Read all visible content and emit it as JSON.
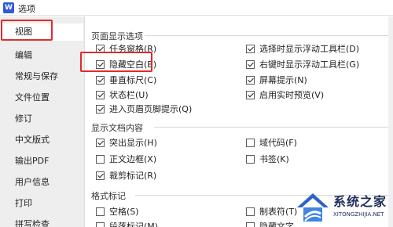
{
  "window": {
    "title": "选项",
    "app_icon_letter": "W"
  },
  "sidebar": {
    "items": [
      {
        "label": "视图",
        "active": true
      },
      {
        "label": "编辑"
      },
      {
        "label": "常规与保存"
      },
      {
        "label": "文件位置"
      },
      {
        "label": "修订"
      },
      {
        "label": "中文版式"
      },
      {
        "label": "输出PDF"
      },
      {
        "label": "用户信息"
      },
      {
        "label": "打印"
      },
      {
        "label": "拼写检查"
      }
    ]
  },
  "sections": {
    "page_display": {
      "title": "页面显示选项",
      "options": [
        {
          "label": "任务窗格(R)",
          "checked": true
        },
        {
          "label": "隐藏空白(B)",
          "checked": true
        },
        {
          "label": "垂直标尺(C)",
          "checked": true
        },
        {
          "label": "状态栏(U)",
          "checked": true
        },
        {
          "label": "进入页眉页脚提示(Q)",
          "checked": true
        },
        {
          "label": "选择时显示浮动工具栏(D)",
          "checked": true
        },
        {
          "label": "右键时显示浮动工具栏(G)",
          "checked": true
        },
        {
          "label": "屏幕提示(N)",
          "checked": true
        },
        {
          "label": "启用实时预览(V)",
          "checked": true
        }
      ]
    },
    "doc_content": {
      "title": "显示文档内容",
      "options": [
        {
          "label": "突出显示(H)",
          "checked": true
        },
        {
          "label": "正文边框(X)",
          "checked": false
        },
        {
          "label": "裁剪标记(R)",
          "checked": true
        },
        {
          "label": "域代码(F)",
          "checked": false
        },
        {
          "label": "书签(K)",
          "checked": false
        }
      ]
    },
    "format_marks": {
      "title": "格式标记",
      "options": [
        {
          "label": "空格(S)",
          "checked": false
        },
        {
          "label": "段落标记(M)",
          "checked": false
        },
        {
          "label": "制表符(T)",
          "checked": false
        },
        {
          "label": "隐藏文字",
          "checked": false
        }
      ]
    }
  },
  "watermark": {
    "text": "系统之家",
    "url": "XITONGZHIJIA.NET"
  },
  "colors": {
    "highlight": "#e02b2b",
    "logo": "#2f5bd8"
  }
}
